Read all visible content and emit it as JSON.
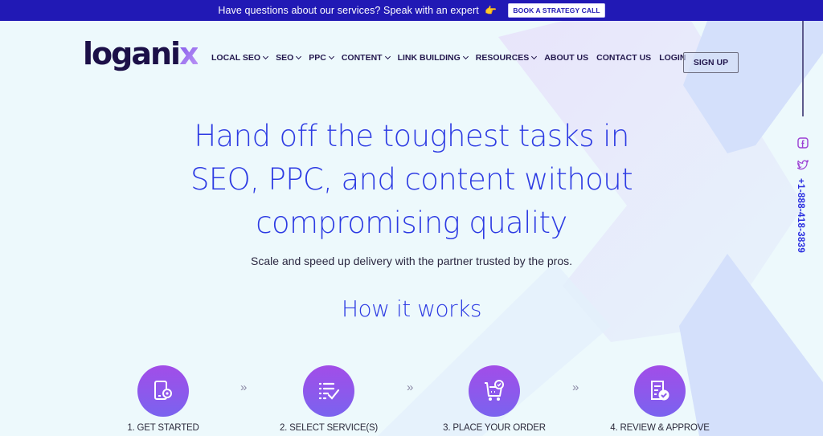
{
  "banner": {
    "message": "Have questions about our services? Speak with an expert",
    "hand_icon": "👉",
    "cta_label": "BOOK A STRATEGY CALL"
  },
  "header": {
    "logo_main": "logani",
    "logo_accent": "x",
    "nav": [
      {
        "label": "LOCAL SEO",
        "dropdown": true
      },
      {
        "label": "SEO",
        "dropdown": true
      },
      {
        "label": "PPC",
        "dropdown": true
      },
      {
        "label": "CONTENT",
        "dropdown": true
      },
      {
        "label": "LINK BUILDING",
        "dropdown": true
      },
      {
        "label": "RESOURCES",
        "dropdown": true
      },
      {
        "label": "ABOUT US",
        "dropdown": false
      },
      {
        "label": "CONTACT US",
        "dropdown": false
      },
      {
        "label": "LOGIN",
        "dropdown": false
      }
    ],
    "signup_label": "SIGN UP"
  },
  "social": {
    "icons": [
      "facebook-icon",
      "twitter-icon"
    ],
    "phone": "+1-888-418-3839"
  },
  "hero": {
    "title_lines": [
      "Hand off the toughest tasks in",
      "SEO, PPC, and content without",
      "compromising quality"
    ],
    "subtitle": "Scale and speed up delivery with the partner trusted by the pros."
  },
  "how_it_works": {
    "title": "How it works",
    "separator": "»",
    "steps": [
      {
        "label": "1. GET STARTED",
        "icon": "phone-gear-icon"
      },
      {
        "label": "2. SELECT SERVICE(S)",
        "icon": "checklist-icon"
      },
      {
        "label": "3. PLACE YOUR ORDER",
        "icon": "cart-check-icon"
      },
      {
        "label": "4. REVIEW & APPROVE",
        "icon": "document-check-icon"
      }
    ]
  },
  "colors": {
    "banner_bg": "#2119b5",
    "accent_blue": "#2d3be3",
    "step_gradient_top": "#a24de8",
    "step_gradient_bottom": "#7a63ef",
    "page_bg": "#edf9fc"
  }
}
